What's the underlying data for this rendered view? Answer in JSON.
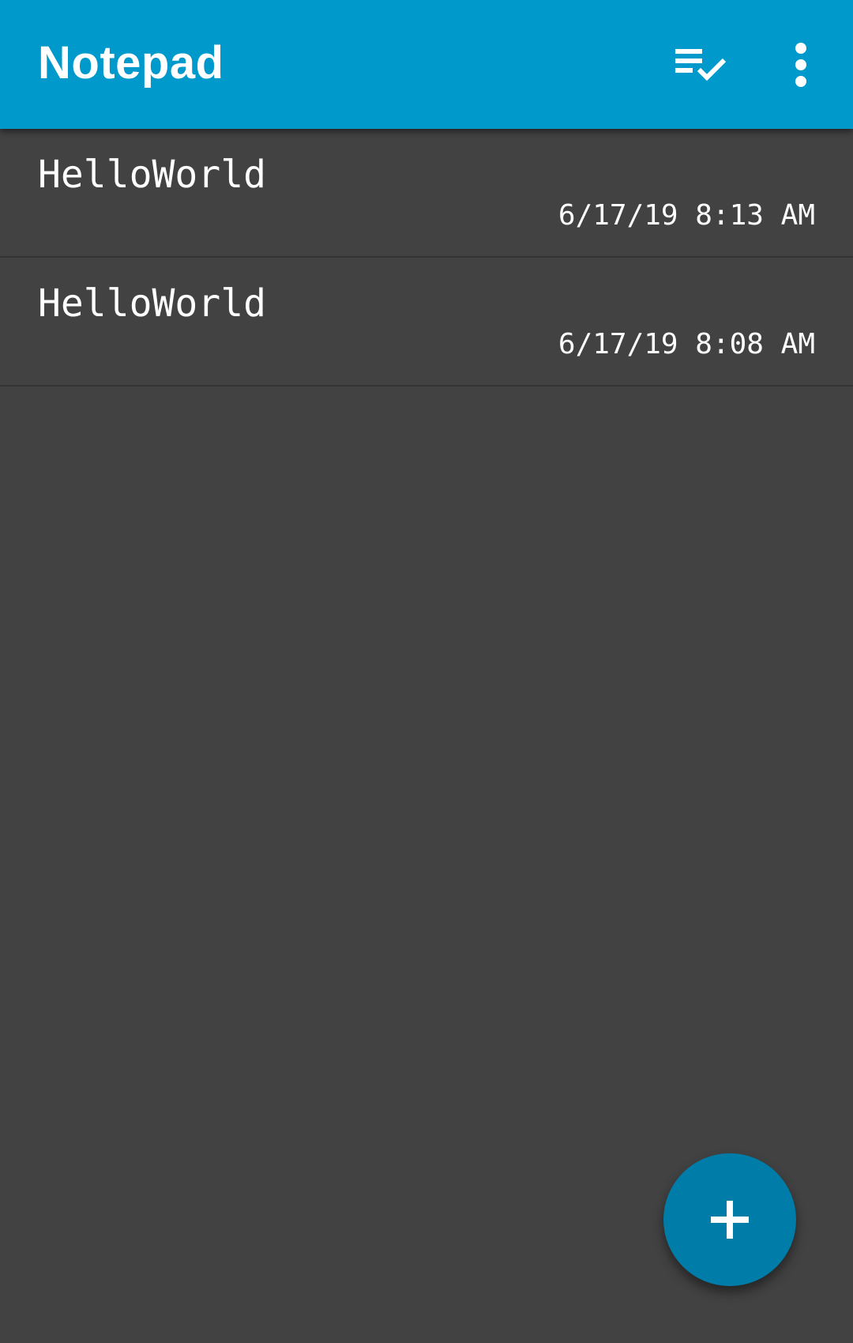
{
  "app_bar": {
    "title": "Notepad",
    "background_color": "#0099cc",
    "actions": [
      {
        "icon": "select-all-icon",
        "description": "list with checkmark"
      },
      {
        "icon": "more-vertical-icon",
        "description": "three vertical dots"
      }
    ]
  },
  "notes": [
    {
      "title": "HelloWorld",
      "date": "6/17/19 8:13 AM"
    },
    {
      "title": "HelloWorld",
      "date": "6/17/19 8:08 AM"
    }
  ],
  "fab": {
    "icon": "plus-icon",
    "color": "#007ca8"
  },
  "colors": {
    "background": "#424242",
    "text": "#ffffff"
  }
}
